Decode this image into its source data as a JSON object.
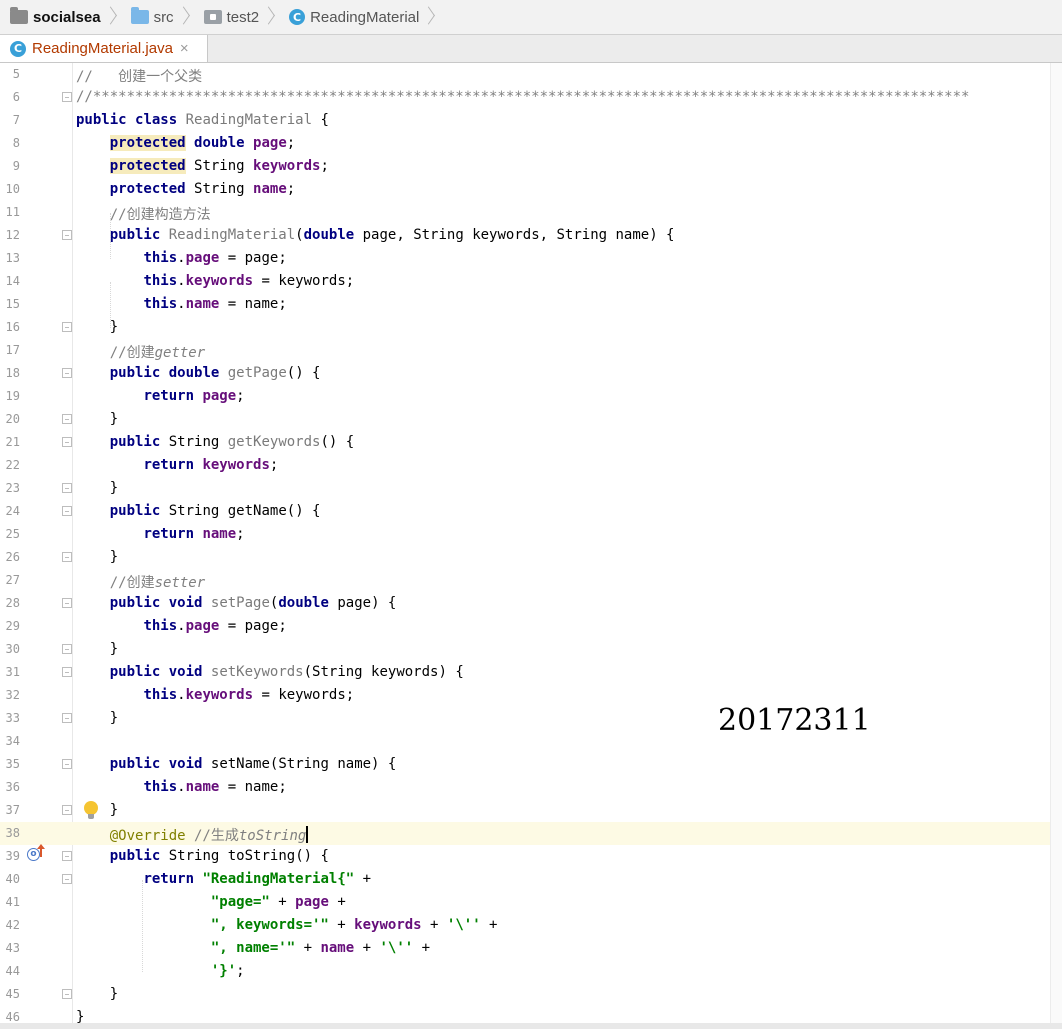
{
  "breadcrumb": {
    "items": [
      {
        "label": "socialsea",
        "icon": "project-folder-icon"
      },
      {
        "label": "src",
        "icon": "source-folder-icon"
      },
      {
        "label": "test2",
        "icon": "package-icon"
      },
      {
        "label": "ReadingMaterial",
        "icon": "class-icon"
      }
    ]
  },
  "tabs": [
    {
      "label": "ReadingMaterial.java",
      "icon": "class-icon",
      "close": "×",
      "active": true
    }
  ],
  "editor": {
    "current_line": 38,
    "lines": [
      {
        "n": "5"
      },
      {
        "n": "6"
      },
      {
        "n": "7"
      },
      {
        "n": "8"
      },
      {
        "n": "9"
      },
      {
        "n": "10"
      },
      {
        "n": "11"
      },
      {
        "n": "12"
      },
      {
        "n": "13"
      },
      {
        "n": "14"
      },
      {
        "n": "15"
      },
      {
        "n": "16"
      },
      {
        "n": "17"
      },
      {
        "n": "18"
      },
      {
        "n": "19"
      },
      {
        "n": "20"
      },
      {
        "n": "21"
      },
      {
        "n": "22"
      },
      {
        "n": "23"
      },
      {
        "n": "24"
      },
      {
        "n": "25"
      },
      {
        "n": "26"
      },
      {
        "n": "27"
      },
      {
        "n": "28"
      },
      {
        "n": "29"
      },
      {
        "n": "30"
      },
      {
        "n": "31"
      },
      {
        "n": "32"
      },
      {
        "n": "33"
      },
      {
        "n": "34"
      },
      {
        "n": "35"
      },
      {
        "n": "36"
      },
      {
        "n": "37"
      },
      {
        "n": "38"
      },
      {
        "n": "39"
      },
      {
        "n": "40"
      },
      {
        "n": "41"
      },
      {
        "n": "42"
      },
      {
        "n": "43"
      },
      {
        "n": "44"
      },
      {
        "n": "45"
      },
      {
        "n": "46"
      }
    ],
    "tokens": {
      "c5": "//   创建一个父类",
      "c6": "//********************************************************************************************************",
      "k_public": "public",
      "k_class": "class",
      "k_protected": "protected",
      "k_double": "double",
      "k_this": "this",
      "k_return": "return",
      "k_void": "void",
      "t_String": "String",
      "cls": "ReadingMaterial",
      "f_page": "page",
      "f_keywords": "keywords",
      "f_name": "name",
      "brace_open": " {",
      "brace_close": "}",
      "semi": ";",
      "dot": ".",
      "c11": "//创建构造方法",
      "ctor_params_a": "(",
      "ctor_params_b": " page, String keywords, String name) {",
      "assign_page": " = page;",
      "assign_keywords": " = keywords;",
      "assign_name": " = name;",
      "c17a": "//创建",
      "c17b": "getter",
      "m_getPage": "getPage",
      "m_getKeywords": "getKeywords",
      "m_getName": "getName",
      "parens_brace": "() {",
      "c27a": "//创建",
      "c27b": "setter",
      "m_setPage": "setPage",
      "m_setKeywords": "setKeywords",
      "m_setName": "setName",
      "p_double_page": " page) {",
      "p_string_keywords": "(String keywords) {",
      "p_string_name": "(String name) {",
      "ann_override": "@Override",
      "c38a": " //生成",
      "c38b": "toString",
      "m_toString": "toString",
      "s40": "\"ReadingMaterial{\"",
      "plus": " +",
      "s41": "\"page=\"",
      "s42": "\", keywords='\"",
      "s_quote_char": "'\\''",
      "s43": "\", name='\"",
      "s44": "'}'",
      "plus_mid": " + "
    }
  },
  "watermark": "20172311"
}
